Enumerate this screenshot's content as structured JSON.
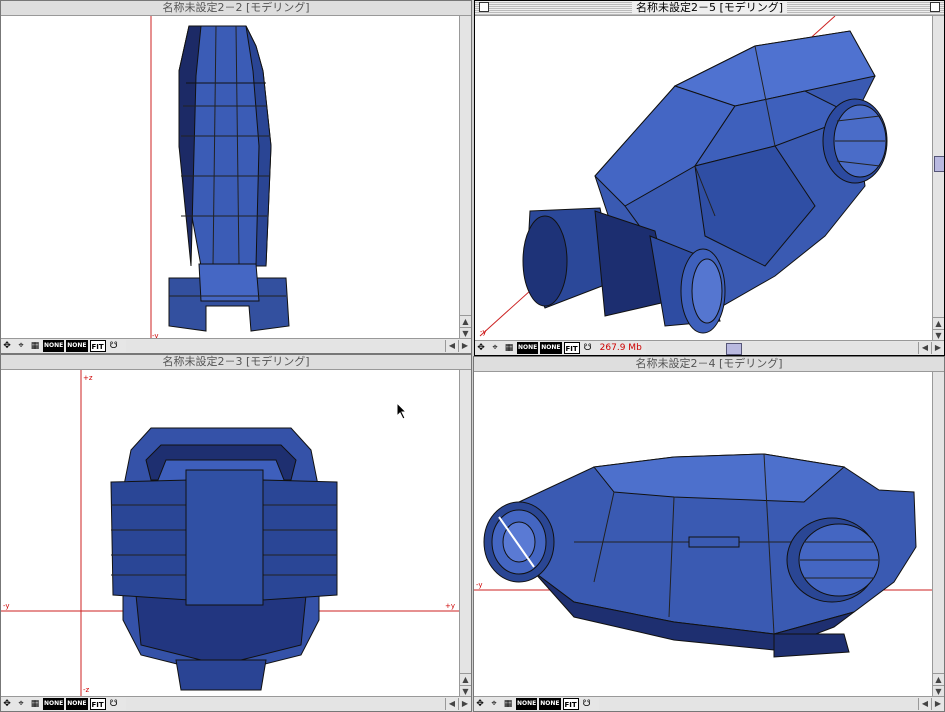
{
  "colors": {
    "model": "#3a5ab0",
    "model_dark": "#1e2f6e",
    "axis": "#cc2222"
  },
  "windows": [
    {
      "title": "名称未設定2－2 [モデリング]",
      "axis_bottom": "-y"
    },
    {
      "title": "名称未設定2－5 [モデリング]",
      "axis_bottom": "-y",
      "memory": "267.9 Mb"
    },
    {
      "title": "名称未設定2－3 [モデリング]",
      "axis_top": "+z",
      "axis_bottom": "-z",
      "axis_left": "-y",
      "axis_right": "+y"
    },
    {
      "title": "名称未設定2－4 [モデリング]",
      "axis_left": "-y"
    }
  ],
  "statusbar": {
    "none1": "NONE",
    "none2": "NONE",
    "fit": "FIT"
  },
  "icons": [
    "move-icon",
    "axis-icon",
    "grid-icon",
    "none-icon",
    "none-icon",
    "fit-icon",
    "render-icon",
    "scroll-left-icon",
    "scroll-right-icon",
    "scroll-up-icon",
    "scroll-down-icon",
    "mouse-pointer-icon"
  ]
}
